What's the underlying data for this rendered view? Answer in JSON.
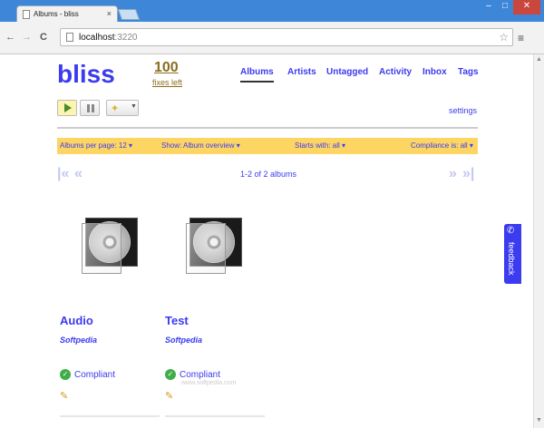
{
  "browser": {
    "tab_title": "Albums - bliss",
    "tab_close": "×",
    "url_host": "localhost",
    "url_port": ":3220",
    "win_min": "–",
    "win_max": "□",
    "win_close": "✕",
    "back": "←",
    "forward": "→",
    "reload": "C",
    "star": "☆",
    "menu": "≡"
  },
  "header": {
    "logo": "bliss",
    "fixes_count": "100",
    "fixes_label": "fixes left"
  },
  "nav": [
    "Albums",
    "Artists",
    "Untagged",
    "Activity",
    "Inbox",
    "Tags"
  ],
  "settings_label": "settings",
  "filters": [
    "Albums per page: 12 ▾",
    "Show: Album overview ▾",
    "Starts with: all ▾",
    "Compliance is: all ▾"
  ],
  "pager": {
    "first": "|«",
    "prev": "«",
    "next": "»",
    "last": "»|",
    "count": "1-2 of 2 albums"
  },
  "albums": [
    {
      "title": "Audio",
      "artist": "Softpedia",
      "status": "Compliant"
    },
    {
      "title": "Test",
      "artist": "Softpedia",
      "status": "Compliant"
    }
  ],
  "watermark": "www.softpedia.com",
  "feedback_label": "feedback",
  "colors": {
    "accent": "#3b3bf0",
    "filterbar": "#fdd563",
    "compliant": "#3fae49"
  }
}
